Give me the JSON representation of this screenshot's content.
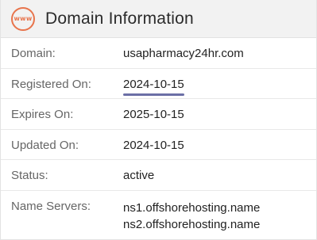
{
  "header": {
    "icon_text": "www",
    "title": "Domain Information"
  },
  "rows": [
    {
      "label": "Domain:",
      "value": "usapharmacy24hr.com"
    },
    {
      "label": "Registered On:",
      "value": "2024-10-15"
    },
    {
      "label": "Expires On:",
      "value": "2025-10-15"
    },
    {
      "label": "Updated On:",
      "value": "2024-10-15"
    },
    {
      "label": "Status:",
      "value": "active"
    }
  ],
  "name_servers": {
    "label": "Name Servers:",
    "values": [
      "ns1.offshorehosting.name",
      "ns2.offshorehosting.name"
    ]
  },
  "colors": {
    "accent": "#e8744c",
    "underline": "#6b6fa6",
    "header_bg": "#f2f2f2"
  }
}
